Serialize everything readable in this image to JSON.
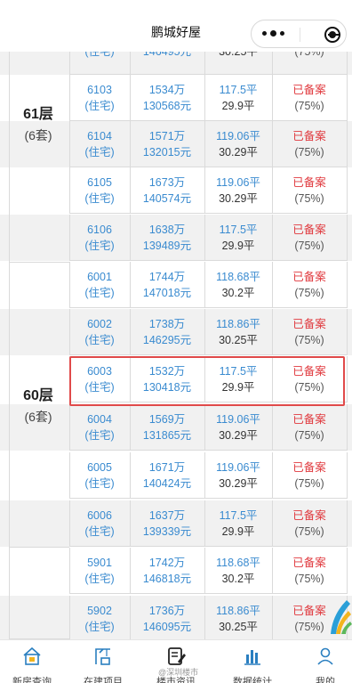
{
  "header": {
    "title": "鹏城好屋"
  },
  "colors": {
    "link_blue": "#3a8bd0",
    "status_red": "#e0393e",
    "highlight_red": "#e04a4a"
  },
  "floors": [
    {
      "floor": "61层",
      "count": "(6套)"
    },
    {
      "floor": "60层",
      "count": "(6套)"
    }
  ],
  "rows": [
    {
      "unit": "",
      "type": "(住宅)",
      "total": "",
      "unit_price": "146495元",
      "area": "",
      "inner_area": "30.25平",
      "status": "",
      "ratio": "(75%)"
    },
    {
      "unit": "6103",
      "type": "(住宅)",
      "total": "1534万",
      "unit_price": "130568元",
      "area": "117.5平",
      "inner_area": "29.9平",
      "status": "已备案",
      "ratio": "(75%)"
    },
    {
      "unit": "6104",
      "type": "(住宅)",
      "total": "1571万",
      "unit_price": "132015元",
      "area": "119.06平",
      "inner_area": "30.29平",
      "status": "已备案",
      "ratio": "(75%)"
    },
    {
      "unit": "6105",
      "type": "(住宅)",
      "total": "1673万",
      "unit_price": "140574元",
      "area": "119.06平",
      "inner_area": "30.29平",
      "status": "已备案",
      "ratio": "(75%)"
    },
    {
      "unit": "6106",
      "type": "(住宅)",
      "total": "1638万",
      "unit_price": "139489元",
      "area": "117.5平",
      "inner_area": "29.9平",
      "status": "已备案",
      "ratio": "(75%)"
    },
    {
      "unit": "6001",
      "type": "(住宅)",
      "total": "1744万",
      "unit_price": "147018元",
      "area": "118.68平",
      "inner_area": "30.2平",
      "status": "已备案",
      "ratio": "(75%)"
    },
    {
      "unit": "6002",
      "type": "(住宅)",
      "total": "1738万",
      "unit_price": "146295元",
      "area": "118.86平",
      "inner_area": "30.25平",
      "status": "已备案",
      "ratio": "(75%)"
    },
    {
      "unit": "6003",
      "type": "(住宅)",
      "total": "1532万",
      "unit_price": "130418元",
      "area": "117.5平",
      "inner_area": "29.9平",
      "status": "已备案",
      "ratio": "(75%)"
    },
    {
      "unit": "6004",
      "type": "(住宅)",
      "total": "1569万",
      "unit_price": "131865元",
      "area": "119.06平",
      "inner_area": "30.29平",
      "status": "已备案",
      "ratio": "(75%)"
    },
    {
      "unit": "6005",
      "type": "(住宅)",
      "total": "1671万",
      "unit_price": "140424元",
      "area": "119.06平",
      "inner_area": "30.29平",
      "status": "已备案",
      "ratio": "(75%)"
    },
    {
      "unit": "6006",
      "type": "(住宅)",
      "total": "1637万",
      "unit_price": "139339元",
      "area": "117.5平",
      "inner_area": "29.9平",
      "status": "已备案",
      "ratio": "(75%)"
    },
    {
      "unit": "5901",
      "type": "(住宅)",
      "total": "1742万",
      "unit_price": "146818元",
      "area": "118.68平",
      "inner_area": "30.2平",
      "status": "已备案",
      "ratio": "(75%)"
    },
    {
      "unit": "5902",
      "type": "(住宅)",
      "total": "1736万",
      "unit_price": "146095元",
      "area": "118.86平",
      "inner_area": "30.25平",
      "status": "已备案",
      "ratio": "(75%)"
    }
  ],
  "nav": [
    {
      "label": "新房查询",
      "icon": "house-icon"
    },
    {
      "label": "在建项目",
      "icon": "crane-icon"
    },
    {
      "label": "楼市资讯",
      "icon": "notepad-icon"
    },
    {
      "label": "数据统计",
      "icon": "bar-chart-icon"
    },
    {
      "label": "我的",
      "icon": "person-icon"
    }
  ],
  "watermark": "@深圳楼市"
}
